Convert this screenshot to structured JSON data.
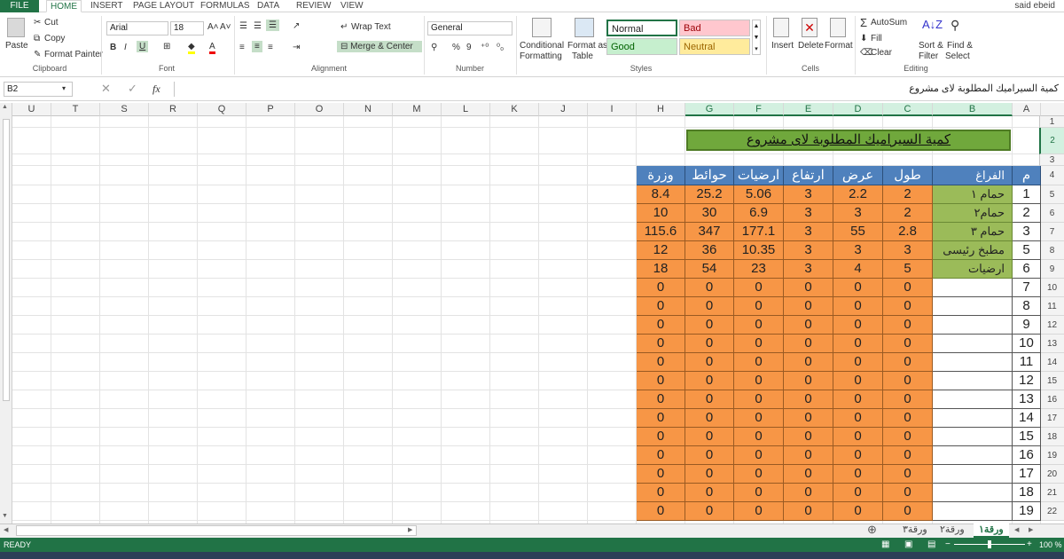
{
  "tabs": {
    "file": "FILE",
    "items": [
      "HOME",
      "INSERT",
      "PAGE LAYOUT",
      "FORMULAS",
      "DATA",
      "REVIEW",
      "VIEW"
    ],
    "user": "said ebeid"
  },
  "ribbon": {
    "clipboard": {
      "paste": "Paste",
      "cut": "Cut",
      "copy": "Copy",
      "format_painter": "Format Painter",
      "label": "Clipboard"
    },
    "font": {
      "name": "Arial",
      "size": "18",
      "bold": "B",
      "italic": "I",
      "underline": "U",
      "label": "Font"
    },
    "alignment": {
      "wrap": "Wrap Text",
      "merge": "Merge & Center",
      "label": "Alignment"
    },
    "number": {
      "format": "General",
      "percent": "%",
      "comma": "9",
      "label": "Number"
    },
    "styles": {
      "conditional": "Conditional",
      "formatting": "Formatting",
      "format_as": "Format as",
      "table": "Table",
      "normal": "Normal",
      "bad": "Bad",
      "good": "Good",
      "neutral": "Neutral",
      "label": "Styles"
    },
    "cells": {
      "insert": "Insert",
      "delete": "Delete",
      "format": "Format",
      "label": "Cells"
    },
    "editing": {
      "autosum": "AutoSum",
      "fill": "Fill",
      "clear": "Clear",
      "sort": "Sort &",
      "filter": "Filter",
      "find": "Find &",
      "select": "Select",
      "label": "Editing"
    }
  },
  "formula_bar": {
    "name_box": "B2",
    "fx": "fx",
    "content": "كمية السيراميك المطلوبة لاى مشروع"
  },
  "columns": [
    "U",
    "T",
    "S",
    "R",
    "Q",
    "P",
    "O",
    "N",
    "M",
    "L",
    "K",
    "J",
    "I",
    "H",
    "G",
    "F",
    "E",
    "D",
    "C",
    "B",
    "A"
  ],
  "rows": [
    "1",
    "2",
    "3",
    "4",
    "5",
    "6",
    "7",
    "8",
    "9",
    "10",
    "11",
    "12",
    "13",
    "14",
    "15",
    "16",
    "17",
    "18",
    "19",
    "20",
    "21",
    "22"
  ],
  "sheet": {
    "title": "كمية السيراميك المطلوبة لاى مشروع",
    "headers": {
      "A": "م",
      "B": "الفراغ",
      "C": "طول",
      "D": "عرض",
      "E": "ارتفاع",
      "F": "ارضيات",
      "G": "حوائط",
      "H": "وزرة"
    },
    "data": [
      {
        "A": "1",
        "B": "حمام ١",
        "C": "2",
        "D": "2.2",
        "E": "3",
        "F": "5.06",
        "G": "25.2",
        "H": "8.4"
      },
      {
        "A": "2",
        "B": "حمام٢",
        "C": "2",
        "D": "3",
        "E": "3",
        "F": "6.9",
        "G": "30",
        "H": "10"
      },
      {
        "A": "3",
        "B": "حمام ٣",
        "C": "2.8",
        "D": "55",
        "E": "3",
        "F": "177.1",
        "G": "347",
        "H": "115.6"
      },
      {
        "A": "5",
        "B": "مطبخ رئيسى",
        "C": "3",
        "D": "3",
        "E": "3",
        "F": "10.35",
        "G": "36",
        "H": "12"
      },
      {
        "A": "6",
        "B": "ارضيات",
        "C": "5",
        "D": "4",
        "E": "3",
        "F": "23",
        "G": "54",
        "H": "18"
      },
      {
        "A": "7",
        "B": "",
        "C": "0",
        "D": "0",
        "E": "0",
        "F": "0",
        "G": "0",
        "H": "0"
      },
      {
        "A": "8",
        "B": "",
        "C": "0",
        "D": "0",
        "E": "0",
        "F": "0",
        "G": "0",
        "H": "0"
      },
      {
        "A": "9",
        "B": "",
        "C": "0",
        "D": "0",
        "E": "0",
        "F": "0",
        "G": "0",
        "H": "0"
      },
      {
        "A": "10",
        "B": "",
        "C": "0",
        "D": "0",
        "E": "0",
        "F": "0",
        "G": "0",
        "H": "0"
      },
      {
        "A": "11",
        "B": "",
        "C": "0",
        "D": "0",
        "E": "0",
        "F": "0",
        "G": "0",
        "H": "0"
      },
      {
        "A": "12",
        "B": "",
        "C": "0",
        "D": "0",
        "E": "0",
        "F": "0",
        "G": "0",
        "H": "0"
      },
      {
        "A": "13",
        "B": "",
        "C": "0",
        "D": "0",
        "E": "0",
        "F": "0",
        "G": "0",
        "H": "0"
      },
      {
        "A": "14",
        "B": "",
        "C": "0",
        "D": "0",
        "E": "0",
        "F": "0",
        "G": "0",
        "H": "0"
      },
      {
        "A": "15",
        "B": "",
        "C": "0",
        "D": "0",
        "E": "0",
        "F": "0",
        "G": "0",
        "H": "0"
      },
      {
        "A": "16",
        "B": "",
        "C": "0",
        "D": "0",
        "E": "0",
        "F": "0",
        "G": "0",
        "H": "0"
      },
      {
        "A": "17",
        "B": "",
        "C": "0",
        "D": "0",
        "E": "0",
        "F": "0",
        "G": "0",
        "H": "0"
      },
      {
        "A": "18",
        "B": "",
        "C": "0",
        "D": "0",
        "E": "0",
        "F": "0",
        "G": "0",
        "H": "0"
      },
      {
        "A": "19",
        "B": "",
        "C": "0",
        "D": "0",
        "E": "0",
        "F": "0",
        "G": "0",
        "H": "0"
      }
    ]
  },
  "sheet_tabs": {
    "sheet1": "ورقة١",
    "sheet2": "ورقة٢",
    "sheet3": "ورقة٣"
  },
  "status": {
    "ready": "READY",
    "zoom": "100 %"
  },
  "colors": {
    "accent": "#217346",
    "orange": "#f79646",
    "blue": "#4f81bd",
    "green": "#9bbb59",
    "title_green": "#70a83c"
  }
}
